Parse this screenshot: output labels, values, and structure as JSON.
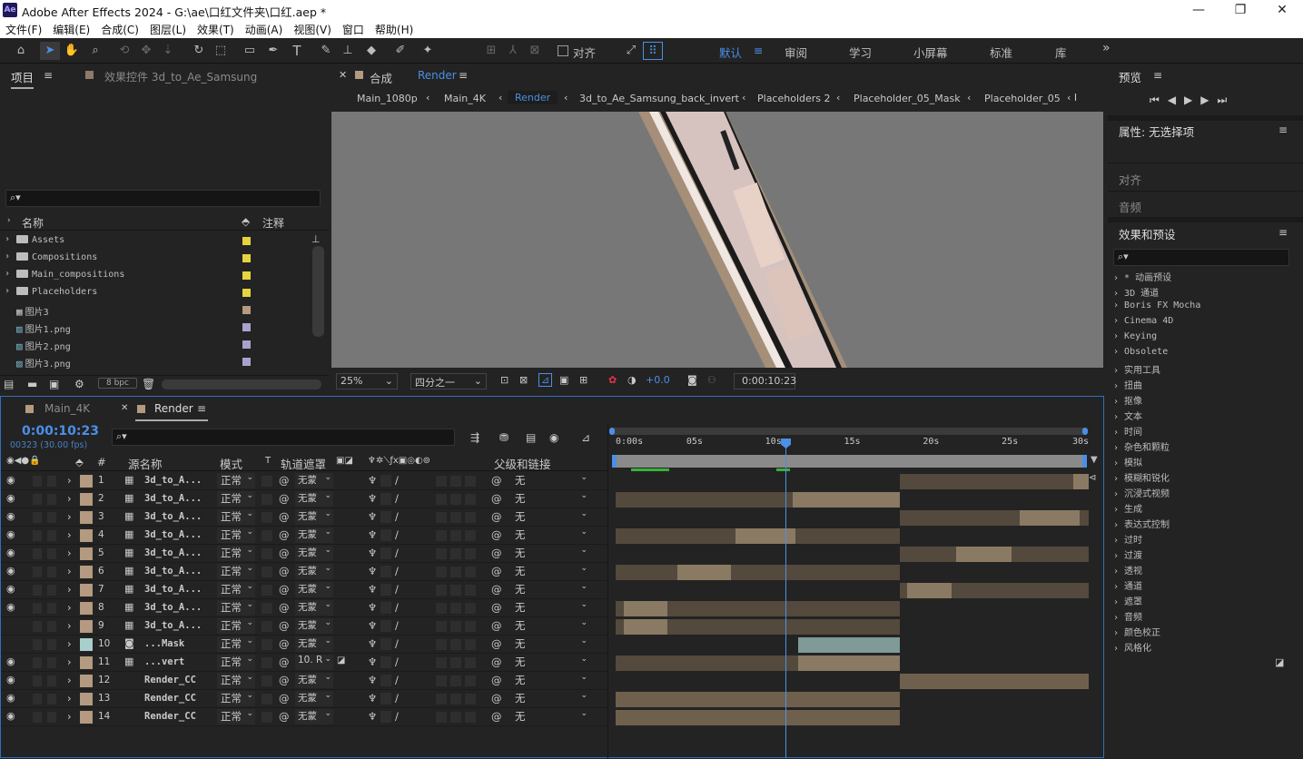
{
  "app": {
    "title": "Adobe After Effects 2024 - G:\\ae\\口红文件夹\\口红.aep *",
    "logo": "Ae"
  },
  "window_controls": [
    "—",
    "❐",
    "✕"
  ],
  "menu": [
    "文件(F)",
    "编辑(E)",
    "合成(C)",
    "图层(L)",
    "效果(T)",
    "动画(A)",
    "视图(V)",
    "窗口",
    "帮助(H)"
  ],
  "toolbar": {
    "align_label": "对齐",
    "workspaces": [
      "默认",
      "审阅",
      "学习",
      "小屏幕",
      "标准",
      "库"
    ],
    "more": "»"
  },
  "project": {
    "tab_project": "项目",
    "tab_effects": "效果控件 3d_to_Ae_Samsung",
    "col_name": "名称",
    "col_comment": "注释",
    "bpc": "8 bpc",
    "items": [
      {
        "name": "Assets",
        "kind": "folder",
        "color": "#e5d43f"
      },
      {
        "name": "Compositions",
        "kind": "folder",
        "color": "#e5d43f"
      },
      {
        "name": "Main_compositions",
        "kind": "folder",
        "color": "#e5d43f"
      },
      {
        "name": "Placeholders",
        "kind": "folder",
        "color": "#e5d43f"
      },
      {
        "name": "图片3",
        "kind": "comp",
        "color": "#b39a80"
      },
      {
        "name": "图片1.png",
        "kind": "file",
        "color": "#a9a2cc"
      },
      {
        "name": "图片2.png",
        "kind": "file",
        "color": "#a9a2cc"
      },
      {
        "name": "图片3.png",
        "kind": "file",
        "color": "#a9a2cc"
      }
    ]
  },
  "comp": {
    "tab_prefix": "合成",
    "tab_name": "Render",
    "breadcrumbs": [
      "Main_1080p",
      "Main_4K",
      "Render",
      "3d_to_Ae_Samsung_back_invert",
      "Placeholders 2",
      "Placeholder_05_Mask",
      "Placeholder_05"
    ],
    "zoom": "25%",
    "resolution": "四分之一",
    "exposure": "+0.0",
    "timecode": "0:00:10:23"
  },
  "preview": {
    "title": "预览"
  },
  "properties": {
    "title": "属性: 无选择项",
    "align": "对齐",
    "audio": "音频"
  },
  "effects": {
    "title": "效果和预设",
    "categories": [
      "* 动画预设",
      "3D 通道",
      "Boris FX Mocha",
      "Cinema 4D",
      "Keying",
      "Obsolete",
      "实用工具",
      "扭曲",
      "抠像",
      "文本",
      "时间",
      "杂色和颗粒",
      "模拟",
      "模糊和锐化",
      "沉浸式视频",
      "生成",
      "表达式控制",
      "过时",
      "过渡",
      "透视",
      "通道",
      "遮罩",
      "音频",
      "颜色校正",
      "风格化"
    ]
  },
  "timeline": {
    "tabs": [
      "Main_4K",
      "Render"
    ],
    "timecode": "0:00:10:23",
    "frames": "00323 (30.00 fps)",
    "headers": {
      "hash": "#",
      "source": "源名称",
      "mode": "模式",
      "t": "T",
      "trkmat": "轨道遮罩",
      "parent": "父级和链接"
    },
    "ruler": [
      "0:00s",
      "05s",
      "10s",
      "15s",
      "20s",
      "25s",
      "30s"
    ],
    "playhead_seconds": 10.77,
    "duration_seconds": 30,
    "layers": [
      {
        "num": "1",
        "name": "3d_to_A...",
        "mode": "正常",
        "matte": "无蒙",
        "parent": "无",
        "vis": true,
        "icon": "comp",
        "bar": [
          18,
          30
        ],
        "hi": [
          29,
          30
        ]
      },
      {
        "num": "2",
        "name": "3d_to_A...",
        "mode": "正常",
        "matte": "无蒙",
        "parent": "无",
        "vis": true,
        "icon": "comp",
        "bar": [
          0,
          18
        ],
        "hi": [
          11.2,
          18
        ]
      },
      {
        "num": "3",
        "name": "3d_to_A...",
        "mode": "正常",
        "matte": "无蒙",
        "parent": "无",
        "vis": true,
        "icon": "comp",
        "bar": [
          18,
          30
        ],
        "hi": [
          25.6,
          29.4
        ]
      },
      {
        "num": "4",
        "name": "3d_to_A...",
        "mode": "正常",
        "matte": "无蒙",
        "parent": "无",
        "vis": true,
        "icon": "comp",
        "bar": [
          0,
          18
        ],
        "hi": [
          7.6,
          11.4
        ]
      },
      {
        "num": "5",
        "name": "3d_to_A...",
        "mode": "正常",
        "matte": "无蒙",
        "parent": "无",
        "vis": true,
        "icon": "comp",
        "bar": [
          18,
          30
        ],
        "hi": [
          21.6,
          25.1
        ]
      },
      {
        "num": "6",
        "name": "3d_to_A...",
        "mode": "正常",
        "matte": "无蒙",
        "parent": "无",
        "vis": true,
        "icon": "comp",
        "bar": [
          0,
          18
        ],
        "hi": [
          3.9,
          7.3
        ]
      },
      {
        "num": "7",
        "name": "3d_to_A...",
        "mode": "正常",
        "matte": "无蒙",
        "parent": "无",
        "vis": true,
        "icon": "comp",
        "bar": [
          18,
          30
        ],
        "hi": [
          18.5,
          21.3
        ]
      },
      {
        "num": "8",
        "name": "3d_to_A...",
        "mode": "正常",
        "matte": "无蒙",
        "parent": "无",
        "vis": true,
        "icon": "comp",
        "bar": [
          0,
          18
        ],
        "hi": [
          0.5,
          3.3
        ]
      },
      {
        "num": "9",
        "name": "3d_to_A...",
        "mode": "正常",
        "matte": "无蒙",
        "parent": "无",
        "vis": false,
        "icon": "comp",
        "bar": [
          0,
          18
        ],
        "hi": [
          0.5,
          3.3
        ]
      },
      {
        "num": "10",
        "name": "...Mask",
        "mode": "正常",
        "matte": "无蒙",
        "parent": "无",
        "vis": false,
        "icon": "mask",
        "bar": [
          11.6,
          18
        ],
        "hi": null,
        "teal": true
      },
      {
        "num": "11",
        "name": "...vert",
        "mode": "正常",
        "matte": "10. R",
        "parent": "无",
        "vis": true,
        "icon": "comp",
        "bar": [
          0,
          18
        ],
        "hi": [
          11.6,
          18
        ]
      },
      {
        "num": "12",
        "name": "Render_CC",
        "mode": "正常",
        "matte": "无蒙",
        "parent": "无",
        "vis": true,
        "icon": "none",
        "bar": [
          18,
          30
        ],
        "hi": [
          18,
          30
        ]
      },
      {
        "num": "13",
        "name": "Render_CC",
        "mode": "正常",
        "matte": "无蒙",
        "parent": "无",
        "vis": true,
        "icon": "none",
        "bar": [
          0,
          18
        ],
        "hi": [
          0,
          18
        ]
      },
      {
        "num": "14",
        "name": "Render_CC",
        "mode": "正常",
        "matte": "无蒙",
        "parent": "无",
        "vis": true,
        "icon": "none",
        "bar": [
          0,
          18
        ],
        "hi": [
          0,
          18
        ]
      }
    ]
  }
}
